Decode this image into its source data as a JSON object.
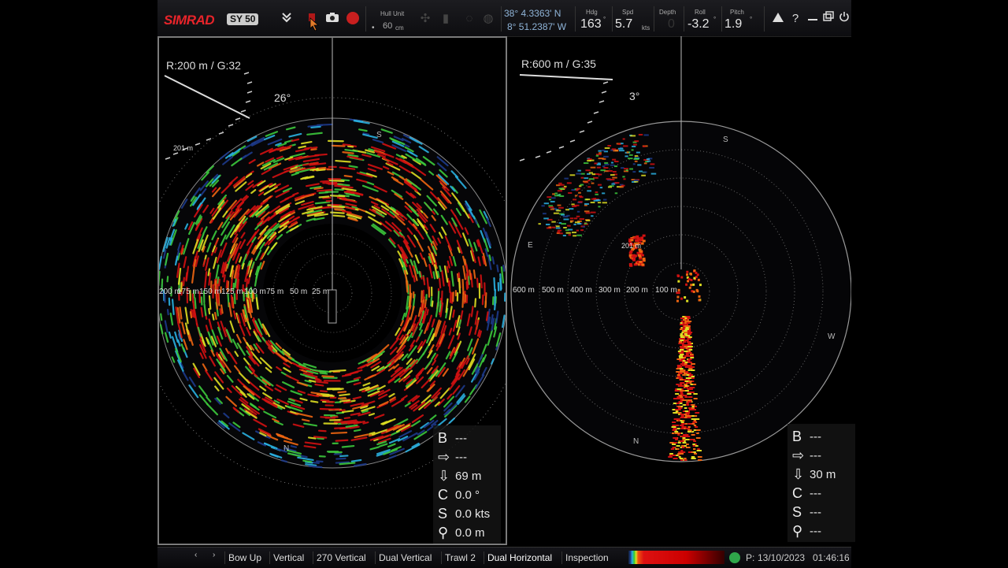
{
  "topbar": {
    "brand": "SIMRAD",
    "model": "SY 50",
    "hull_unit_label": "Hull Unit",
    "hull_unit_value": "60",
    "hull_unit_unit": "cm",
    "lat": "38° 4.3363' N",
    "lon": "8° 51.2387' W",
    "hdg_label": "Hdg",
    "hdg_value": "163",
    "hdg_unit": "°",
    "spd_label": "Spd",
    "spd_value": "5.7",
    "spd_unit": "kts",
    "depth_label": "Depth",
    "depth_value": "0",
    "roll_label": "Roll",
    "roll_value": "-3.2",
    "roll_unit": "°",
    "pitch_label": "Pitch",
    "pitch_value": "1.9",
    "pitch_unit": "°"
  },
  "left_panel": {
    "range_gain": "R:200 m  / G:32",
    "tilt": "26°",
    "marker_label": "201 m",
    "ring_labels": [
      "200 m",
      "175 m",
      "150 m",
      "125 m",
      "100 m",
      "75 m",
      "50 m",
      "25 m"
    ],
    "compass": {
      "S": "S",
      "N": "N"
    },
    "readouts": [
      {
        "icon": "B",
        "value": "---"
      },
      {
        "icon": "⇨",
        "value": "---"
      },
      {
        "icon": "⇩",
        "value": "69 m"
      },
      {
        "icon": "C",
        "value": "0.0 °"
      },
      {
        "icon": "S",
        "value": "0.0 kts"
      },
      {
        "icon": "⚲",
        "value": "0.0 m"
      }
    ]
  },
  "right_panel": {
    "range_gain": "R:600 m  / G:35",
    "tilt": "3°",
    "marker_label": "201 m",
    "ring_labels": [
      "600 m",
      "500 m",
      "400 m",
      "300 m",
      "200 m",
      "100 m"
    ],
    "compass": {
      "S": "S",
      "E": "E",
      "W": "W",
      "N": "N"
    },
    "readouts": [
      {
        "icon": "B",
        "value": "---"
      },
      {
        "icon": "⇨",
        "value": "---"
      },
      {
        "icon": "⇩",
        "value": "30 m"
      },
      {
        "icon": "C",
        "value": "---"
      },
      {
        "icon": "S",
        "value": "---"
      },
      {
        "icon": "⚲",
        "value": "---"
      }
    ]
  },
  "bottombar": {
    "prev": "‹",
    "next": "›",
    "tabs": [
      "Bow Up",
      "Vertical",
      "270 Vertical",
      "Dual Vertical",
      "Trawl 2",
      "Dual Horizontal",
      "Inspection"
    ],
    "active_tab": "Dual Horizontal",
    "status_prefix": "P:",
    "date": "13/10/2023",
    "time": "01:46:16"
  },
  "colors": {
    "brand": "#e8242a",
    "echo_strong": "#d11111",
    "echo_mid": "#dddd22",
    "echo_weak": "#1d3a8a",
    "status_ok": "#2fa64a"
  }
}
